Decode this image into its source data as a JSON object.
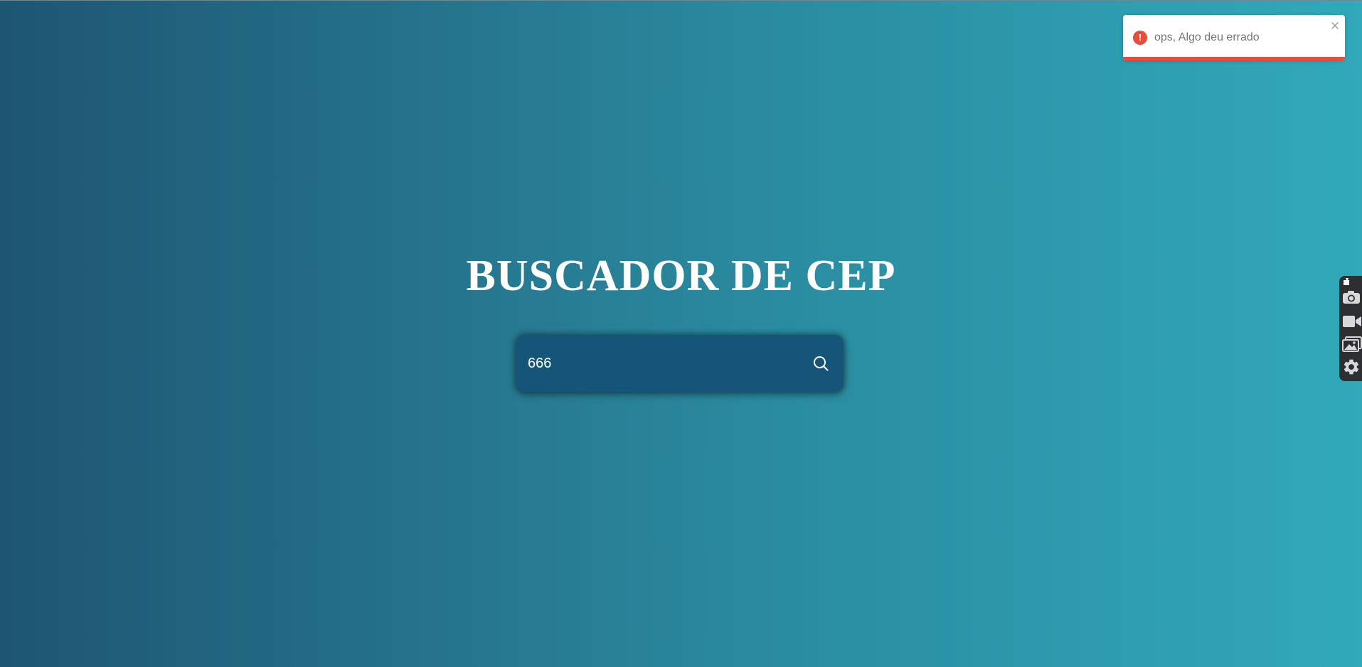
{
  "page": {
    "title": "BUSCADOR DE CEP"
  },
  "search": {
    "value": "666",
    "icon": "search-icon"
  },
  "toast": {
    "message": "ops, Algo deu errado",
    "icon": "error-icon",
    "icon_glyph": "!",
    "close_icon": "close-icon",
    "accent_color": "#e74c3c"
  },
  "side_toolbar": {
    "items": [
      {
        "icon": "pin-icon"
      },
      {
        "icon": "camera-icon"
      },
      {
        "icon": "video-icon"
      },
      {
        "icon": "gallery-icon"
      },
      {
        "icon": "gear-icon"
      }
    ]
  },
  "colors": {
    "background_start": "#1e5572",
    "background_end": "#31a9ba",
    "search_box": "#155578",
    "title": "#ffffff"
  }
}
